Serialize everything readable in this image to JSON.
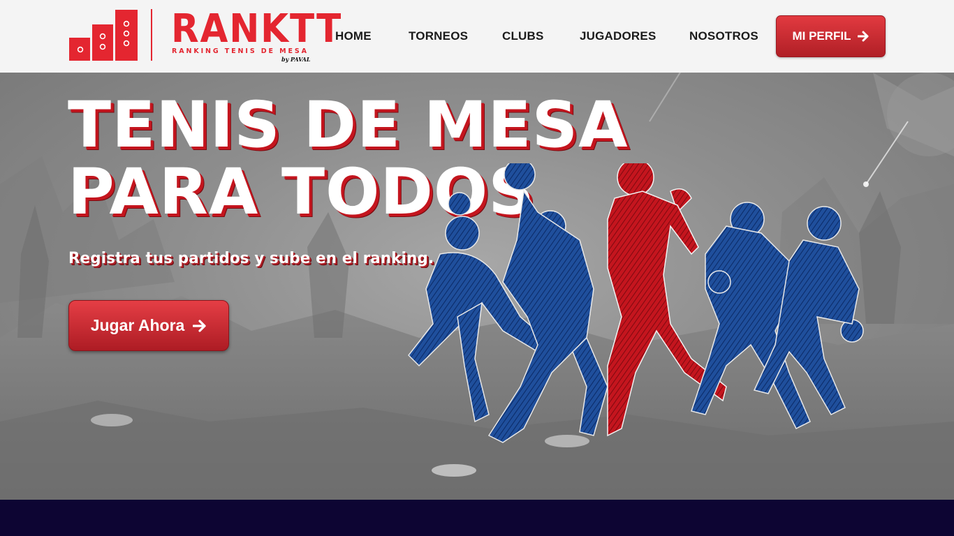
{
  "header": {
    "logo": {
      "name": "RANKTT",
      "tagline": "RANKING TENIS DE MESA",
      "byline": "by PAVAL"
    },
    "nav": [
      {
        "label": "HOME"
      },
      {
        "label": "TORNEOS"
      },
      {
        "label": "CLUBS"
      },
      {
        "label": "JUGADORES"
      },
      {
        "label": "NOSOTROS"
      }
    ],
    "profile_button": {
      "label": "MI PERFIL",
      "icon": "arrow-right-icon"
    }
  },
  "hero": {
    "title_line1": "TENIS DE MESA",
    "title_line2": "PARA TODOS",
    "subtitle": "Registra tus partidos y sube en el ranking.",
    "cta_button": {
      "label": "Jugar Ahora",
      "icon": "arrow-right-icon"
    },
    "illustration": "table-tennis-players-silhouettes"
  },
  "colors": {
    "brand_red": "#e42630",
    "header_bg": "#f4f4f4",
    "player_blue": "#1f4f9c",
    "player_red": "#c4151e",
    "footer_band": "#0d0533"
  }
}
